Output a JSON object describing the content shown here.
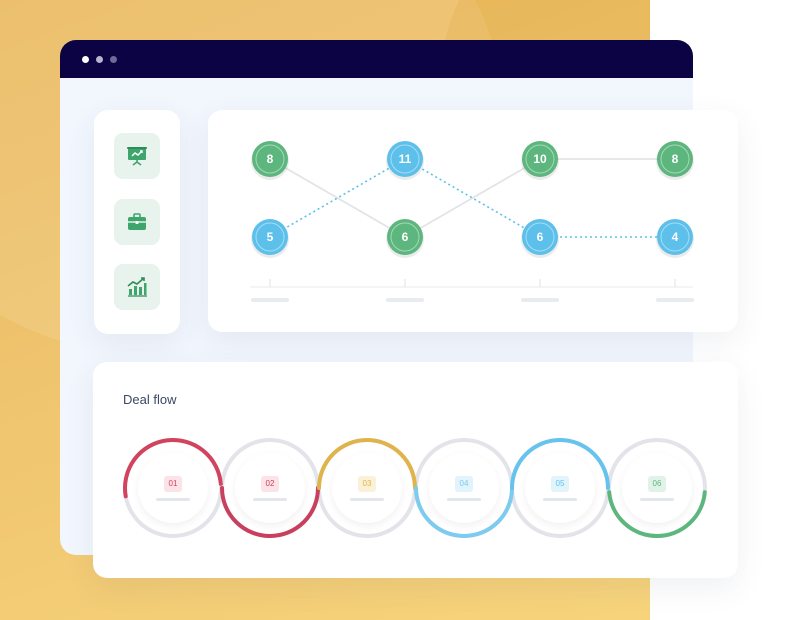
{
  "window": {
    "dots": [
      "close",
      "minimize",
      "zoom"
    ]
  },
  "sidebar": {
    "items": [
      {
        "icon": "presentation-icon"
      },
      {
        "icon": "briefcase-icon"
      },
      {
        "icon": "growth-chart-icon"
      }
    ]
  },
  "flow_chart": {
    "colors": {
      "green": "#5db67e",
      "blue": "#5cc0ea",
      "edge": "#e2e4e8"
    },
    "top_row": [
      {
        "value": "8",
        "color": "green"
      },
      {
        "value": "11",
        "color": "blue"
      },
      {
        "value": "10",
        "color": "green"
      },
      {
        "value": "8",
        "color": "green"
      }
    ],
    "bottom_row": [
      {
        "value": "5",
        "color": "blue"
      },
      {
        "value": "6",
        "color": "green"
      },
      {
        "value": "6",
        "color": "blue"
      },
      {
        "value": "4",
        "color": "blue"
      }
    ]
  },
  "deal_flow": {
    "title": "Deal flow",
    "steps": [
      {
        "label": "01",
        "color": "#d2435e",
        "badge_bg": "#fbe3e8"
      },
      {
        "label": "02",
        "color": "#c8405d",
        "badge_bg": "#fbe3e8"
      },
      {
        "label": "03",
        "color": "#e0b44c",
        "badge_bg": "#fbf0d8"
      },
      {
        "label": "04",
        "color": "#7dcbee",
        "badge_bg": "#e1f4fc"
      },
      {
        "label": "05",
        "color": "#66c3ee",
        "badge_bg": "#e1f4fc"
      },
      {
        "label": "06",
        "color": "#5db67e",
        "badge_bg": "#e1f3e8"
      }
    ]
  }
}
